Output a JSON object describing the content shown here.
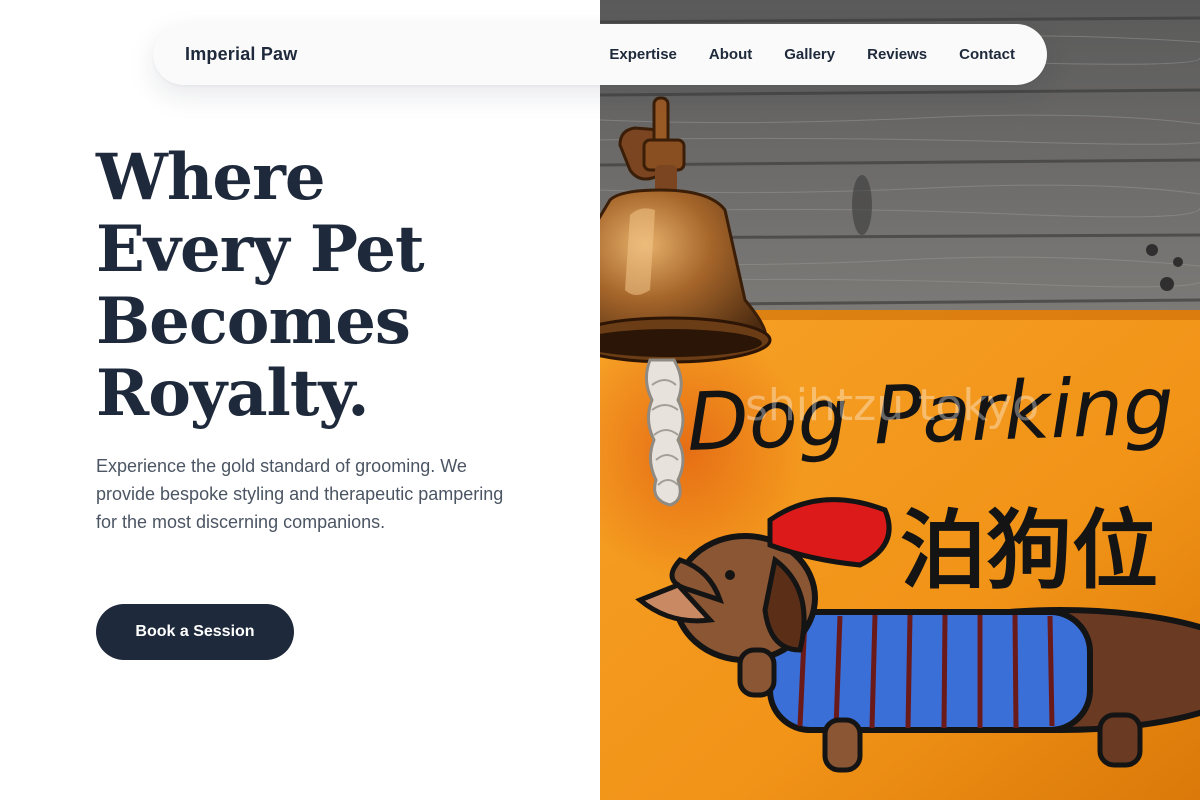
{
  "nav": {
    "brand": "Imperial Paw",
    "links": [
      {
        "label": "Expertise"
      },
      {
        "label": "About"
      },
      {
        "label": "Gallery"
      },
      {
        "label": "Reviews"
      },
      {
        "label": "Contact"
      }
    ]
  },
  "hero": {
    "title_lines": [
      "Where",
      "Every Pet",
      "Becomes",
      "Royalty."
    ],
    "subtitle": "Experience the gold standard of grooming. We provide bespoke styling and therapeutic pampering for the most discerning companions.",
    "cta_label": "Book a Session"
  },
  "photo": {
    "sign_text": "Dog Parking",
    "sign_kanji": "泊狗位",
    "watermark": "shihtzu tokyo",
    "icons": [
      "bell-icon",
      "dachshund-icon"
    ]
  },
  "colors": {
    "primary": "#1e293b",
    "body_text": "#4b5563",
    "sign_orange": "#f39a1c"
  }
}
